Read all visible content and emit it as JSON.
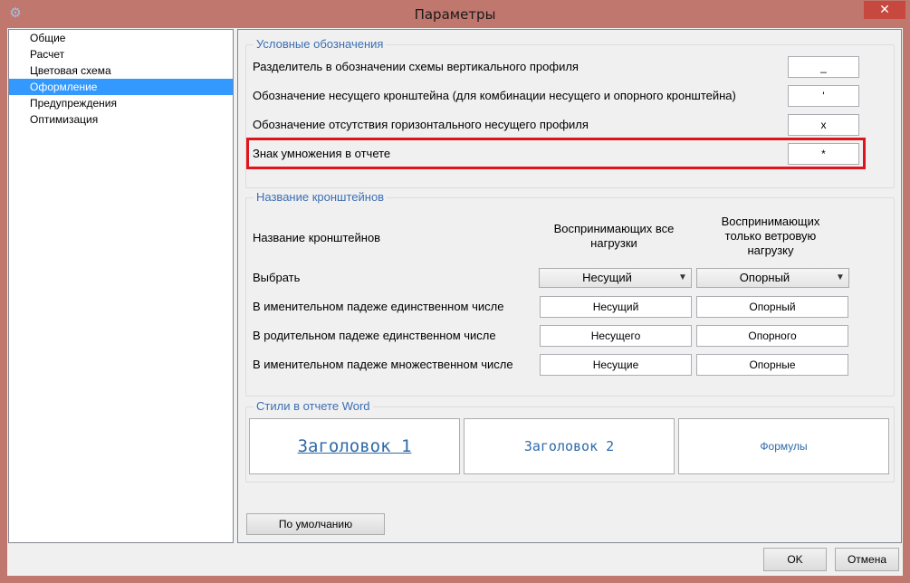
{
  "window": {
    "title": "Параметры",
    "close_glyph": "✕",
    "app_icon": "gear-icon"
  },
  "sidebar": {
    "items": [
      {
        "label": "Общие"
      },
      {
        "label": "Расчет"
      },
      {
        "label": "Цветовая схема"
      },
      {
        "label": "Оформление",
        "selected": true
      },
      {
        "label": "Предупреждения"
      },
      {
        "label": "Оптимизация"
      }
    ]
  },
  "symbols": {
    "title": "Условные обозначения",
    "rows": [
      {
        "label": "Разделитель в обозначении схемы вертикального профиля",
        "value": "_"
      },
      {
        "label": "Обозначение несущего кронштейна (для комбинации несущего и опорного кронштейна)",
        "value": "'"
      },
      {
        "label": "Обозначение отсутствия горизонтального несущего профиля",
        "value": "x"
      },
      {
        "label": "Знак умножения в отчете",
        "value": "*"
      }
    ],
    "highlight_color": "#e0141c"
  },
  "brackets": {
    "title": "Название кронштейнов",
    "header_label": "Название кронштейнов",
    "col1_header": "Воспринимающих все нагрузки",
    "col2_header": "Воспринимающих только ветровую нагрузку",
    "select_label": "Выбрать",
    "select1_value": "Несущий",
    "select2_value": "Опорный",
    "rows": [
      {
        "label": "В именительном падеже единственном числе",
        "v1": "Несущий",
        "v2": "Опорный"
      },
      {
        "label": "В родительном падеже единственном числе",
        "v1": "Несущего",
        "v2": "Опорного"
      },
      {
        "label": "В именительном падеже множественном числе",
        "v1": "Несущие",
        "v2": "Опорные"
      }
    ]
  },
  "word_styles": {
    "title": "Стили в отчете Word",
    "heading1": "Заголовок 1",
    "heading2": "Заголовок 2",
    "formulas": "Формулы",
    "text_color": "#2e6aa8"
  },
  "buttons": {
    "defaults": "По умолчанию",
    "ok": "OK",
    "cancel": "Отмена"
  },
  "colors": {
    "title_bar": "#c0776e",
    "close_button": "#c7483e",
    "selection": "#3399ff",
    "group_title": "#3d6fb4"
  }
}
